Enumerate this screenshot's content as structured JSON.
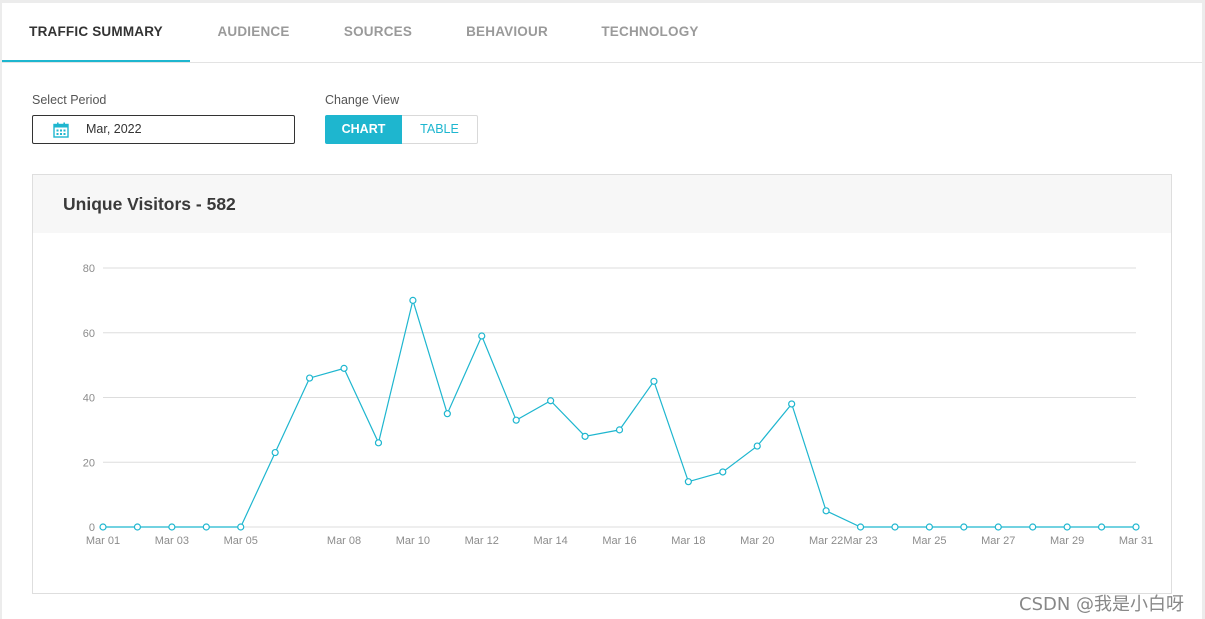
{
  "tabs": [
    {
      "label": "TRAFFIC SUMMARY",
      "active": true
    },
    {
      "label": "AUDIENCE"
    },
    {
      "label": "SOURCES"
    },
    {
      "label": "BEHAVIOUR"
    },
    {
      "label": "TECHNOLOGY"
    }
  ],
  "period": {
    "label": "Select Period",
    "value": "Mar, 2022",
    "icon": "calendar-icon"
  },
  "view": {
    "label": "Change View",
    "chart_label": "CHART",
    "table_label": "TABLE",
    "selected": "CHART"
  },
  "card": {
    "title": "Unique Visitors - 582"
  },
  "colors": {
    "accent": "#1eb6cf",
    "grid": "#dddddd"
  },
  "watermark": "CSDN @我是小白呀",
  "chart_data": {
    "type": "line",
    "title": "Unique Visitors - 582",
    "xlabel": "",
    "ylabel": "",
    "ylim": [
      0,
      80
    ],
    "yticks": [
      0,
      20,
      40,
      60,
      80
    ],
    "grid": true,
    "x": [
      "Mar 01",
      "Mar 02",
      "Mar 03",
      "Mar 04",
      "Mar 05",
      "Mar 06",
      "Mar 07",
      "Mar 08",
      "Mar 09",
      "Mar 10",
      "Mar 11",
      "Mar 12",
      "Mar 13",
      "Mar 14",
      "Mar 15",
      "Mar 16",
      "Mar 17",
      "Mar 18",
      "Mar 19",
      "Mar 20",
      "Mar 21",
      "Mar 22",
      "Mar 23",
      "Mar 24",
      "Mar 25",
      "Mar 26",
      "Mar 27",
      "Mar 28",
      "Mar 29",
      "Mar 30",
      "Mar 31"
    ],
    "xtick_labels": [
      "Mar 01",
      "Mar 03",
      "Mar 05",
      "Mar 08",
      "Mar 10",
      "Mar 12",
      "Mar 14",
      "Mar 16",
      "Mar 18",
      "Mar 20",
      "Mar 22",
      "Mar 23",
      "Mar 25",
      "Mar 27",
      "Mar 29",
      "Mar 31"
    ],
    "series": [
      {
        "values": [
          0,
          0,
          0,
          0,
          0,
          23,
          46,
          49,
          26,
          70,
          35,
          59,
          33,
          39,
          28,
          30,
          45,
          14,
          17,
          25,
          38,
          5,
          0,
          0,
          0,
          0,
          0,
          0,
          0,
          0,
          0
        ]
      }
    ]
  }
}
